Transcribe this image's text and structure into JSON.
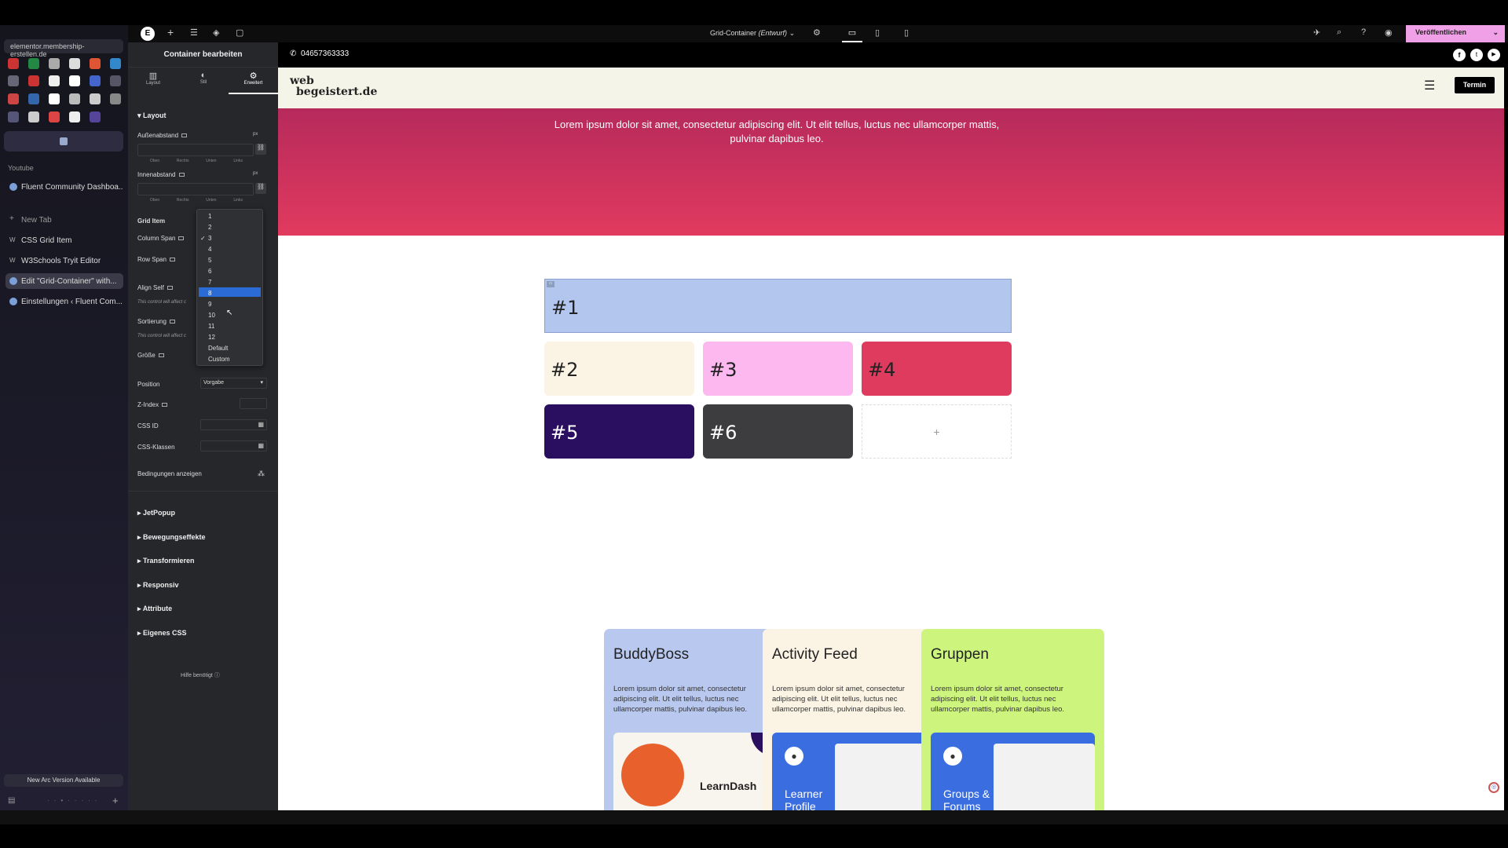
{
  "browser": {
    "url": "elementor.membership-erstellen.de",
    "section_youtube": "Youtube",
    "tabs": [
      "Fluent Community Dashboa...",
      "New Tab",
      "CSS Grid Item",
      "W3Schools Tryit Editor",
      "Edit \"Grid-Container\" with...",
      "Einstellungen ‹ Fluent Com..."
    ],
    "update_notice": "New Arc Version Available"
  },
  "editor": {
    "document_title": "Grid-Container",
    "document_status": "(Entwurf)",
    "publish_label": "Veröffentlichen",
    "panel_title": "Container bearbeiten",
    "panel_tabs": [
      "Layout",
      "Stil",
      "Erweitert"
    ],
    "active_tab": "Erweitert",
    "layout_section": "Layout",
    "margin_label": "Außenabstand",
    "padding_label": "Innenabstand",
    "unit": "px",
    "side_labels": [
      "Oben",
      "Rechts",
      "Unten",
      "Links"
    ],
    "grid_item_label": "Grid Item",
    "column_span_label": "Column Span",
    "row_span_label": "Row Span",
    "align_self_label": "Align Self",
    "align_self_note": "This control will affect c",
    "sorting_label": "Sortierung",
    "sorting_note": "This control will affect c",
    "size_label": "Größe",
    "position_label": "Position",
    "position_value": "Vorgabe",
    "zindex_label": "Z-Index",
    "css_id_label": "CSS ID",
    "css_classes_label": "CSS-Klassen",
    "conditions_label": "Bedingungen anzeigen",
    "collapsed_sections": [
      "JetPopup",
      "Bewegungseffekte",
      "Transformieren",
      "Responsiv",
      "Attribute",
      "Eigenes CSS"
    ],
    "help_label": "Hilfe benötigt",
    "dropdown_options": [
      "1",
      "2",
      "3",
      "4",
      "5",
      "6",
      "7",
      "8",
      "9",
      "10",
      "11",
      "12",
      "Default",
      "Custom"
    ],
    "dropdown_checked": "3",
    "dropdown_highlighted": "8"
  },
  "site": {
    "phone": "04657363333",
    "logo_line1": "web",
    "logo_line2": "begeistert.de",
    "cta_label": "Termin",
    "hero_text": "Lorem ipsum dolor sit amet, consectetur adipiscing elit. Ut elit tellus, luctus nec ullamcorper mattis, pulvinar dapibus leo.",
    "grid_items": [
      "#1",
      "#2",
      "#3",
      "#4",
      "#5",
      "#6"
    ],
    "add_symbol": "+",
    "features": [
      {
        "title": "BuddyBoss",
        "text": "Lorem ipsum dolor sit amet, consectetur adipiscing elit. Ut elit tellus, luctus nec ullamcorper mattis, pulvinar dapibus leo.",
        "image_text": "LearnDash",
        "color": "#b9c8ee"
      },
      {
        "title": "Activity Feed",
        "text": "Lorem ipsum dolor sit amet, consectetur adipiscing elit. Ut elit tellus, luctus nec ullamcorper mattis, pulvinar dapibus leo.",
        "image_text": "Learner Profile",
        "color": "#fbf3e3"
      },
      {
        "title": "Gruppen",
        "text": "Lorem ipsum dolor sit amet, consectetur adipiscing elit. Ut elit tellus, luctus nec ullamcorper mattis, pulvinar dapibus leo.",
        "image_text": "Groups & Forums",
        "color": "#cdf57e"
      }
    ]
  },
  "colors": {
    "hero_top": "#b62a5c",
    "hero_bottom": "#e13a5e",
    "item1": "#b3c6ee",
    "item2": "#fbf3e3",
    "item3": "#fdb8f0",
    "item4": "#de3b5f",
    "item5": "#2a0e5f",
    "item6": "#3d3d3f",
    "publish": "#f0a0e6",
    "highlight": "#2a6bd6"
  }
}
